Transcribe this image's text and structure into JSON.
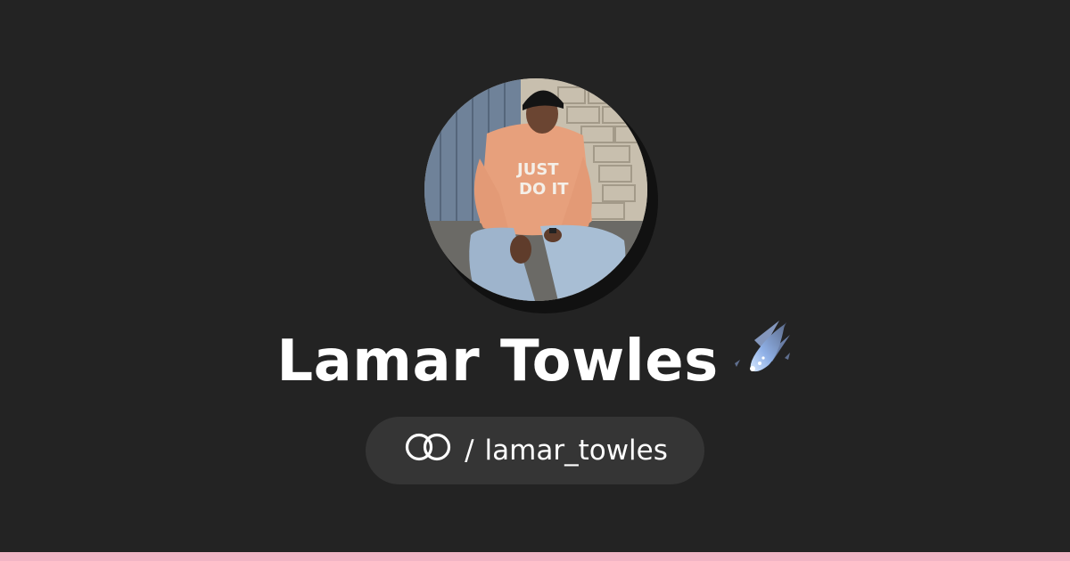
{
  "profile": {
    "display_name": "Lamar Towles",
    "name_emoji": "comet-icon",
    "avatar_alt": "profile photo",
    "handle": "lamar_towles",
    "handle_separator": "/",
    "brand_icon": "linktree-rings-icon"
  },
  "colors": {
    "background": "#232323",
    "pill": "#353535",
    "text": "#ffffff",
    "accent_bar": "#f2b5c5"
  }
}
